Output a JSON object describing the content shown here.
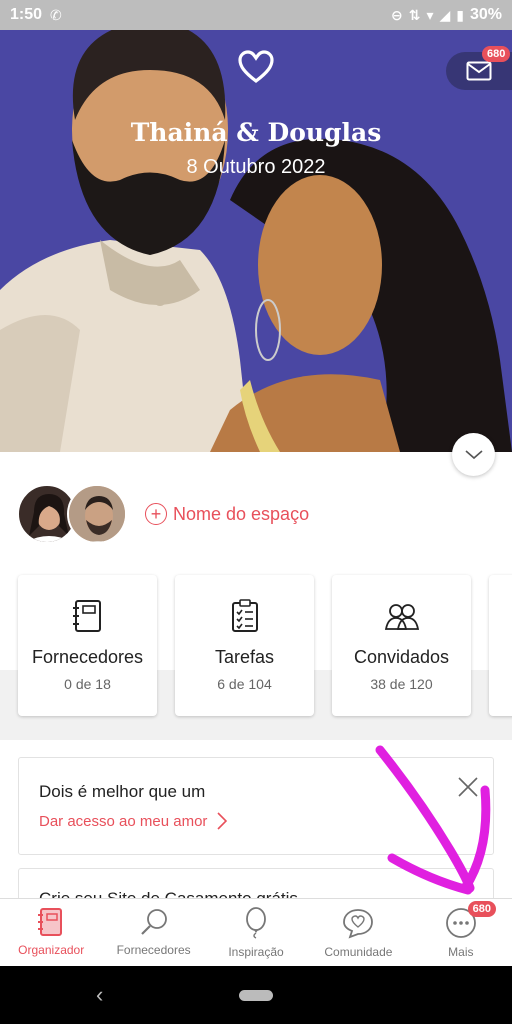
{
  "status_bar": {
    "time": "1:50",
    "battery": "30%"
  },
  "hero": {
    "couple_name": "Thainá & Douglas",
    "date": "8 Outubro 2022",
    "mail_badge": "680"
  },
  "space": {
    "add_label": "Nome do espaço"
  },
  "cards": [
    {
      "title": "Fornecedores",
      "count": "0 de 18",
      "icon": "notebook-icon"
    },
    {
      "title": "Tarefas",
      "count": "6 de 104",
      "icon": "checklist-icon"
    },
    {
      "title": "Convidados",
      "count": "38 de 120",
      "icon": "guests-icon"
    }
  ],
  "promo": {
    "title": "Dois é melhor que um",
    "link": "Dar acesso ao meu amor"
  },
  "promo2": {
    "title": "Crie seu Site de Casamento grátis"
  },
  "bottom_nav": {
    "items": [
      {
        "label": "Organizador",
        "icon": "organizer-icon",
        "active": true
      },
      {
        "label": "Fornecedores",
        "icon": "search-icon"
      },
      {
        "label": "Inspiração",
        "icon": "balloon-icon"
      },
      {
        "label": "Comunidade",
        "icon": "chat-heart-icon"
      },
      {
        "label": "Mais",
        "icon": "more-icon"
      }
    ],
    "more_badge": "680"
  },
  "colors": {
    "accent": "#e8505b",
    "hero_bg": "#4a47a3",
    "annotation": "#e020e0"
  }
}
